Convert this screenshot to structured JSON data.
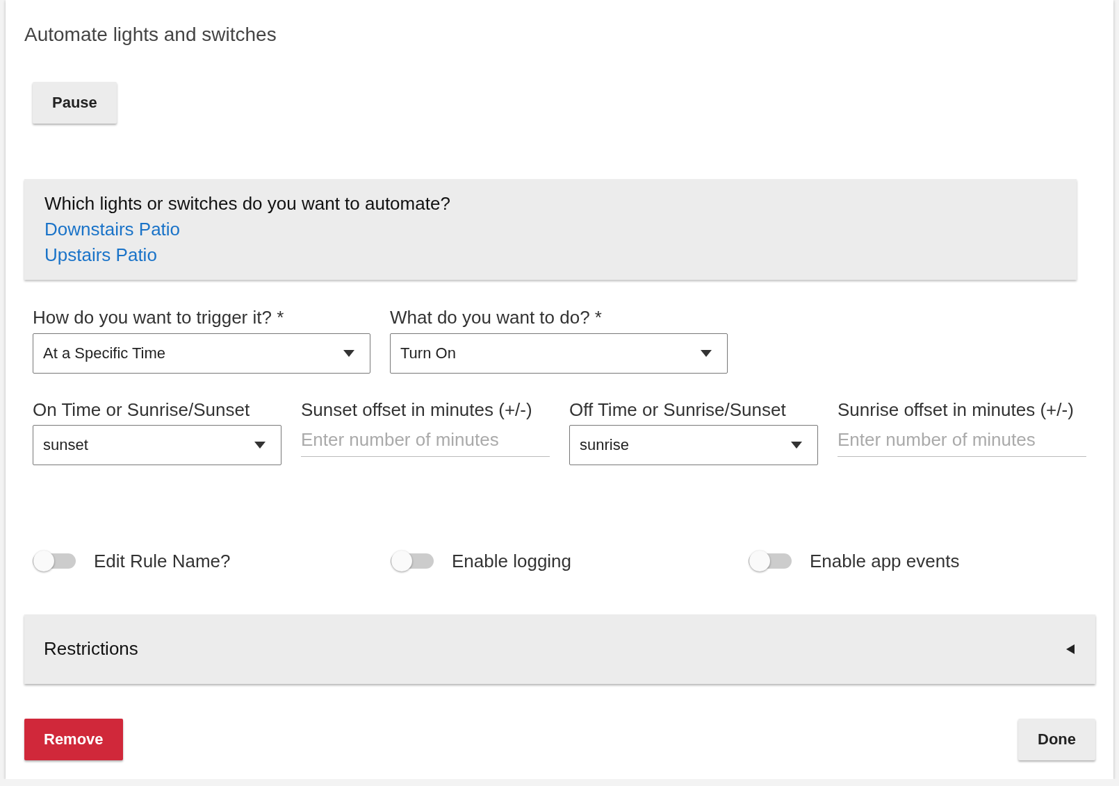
{
  "title": "Automate lights and switches",
  "pause_button": "Pause",
  "devices": {
    "question": "Which lights or switches do you want to automate?",
    "items": [
      "Downstairs Patio",
      "Upstairs Patio"
    ]
  },
  "trigger_row": [
    {
      "kind": "select",
      "label": "How do you want to trigger it? *",
      "value": "At a Specific Time"
    },
    {
      "kind": "select",
      "label": "What do you want to do? *",
      "value": "Turn On"
    }
  ],
  "schedule_row": [
    {
      "kind": "select",
      "label": "On Time or Sunrise/Sunset",
      "value": "sunset"
    },
    {
      "kind": "input",
      "label": "Sunset offset in minutes (+/-)",
      "placeholder": "Enter number of minutes"
    },
    {
      "kind": "select",
      "label": "Off Time or Sunrise/Sunset",
      "value": "sunrise"
    },
    {
      "kind": "input",
      "label": "Sunrise offset in minutes (+/-)",
      "placeholder": "Enter number of minutes"
    }
  ],
  "toggles": [
    {
      "label": "Edit Rule Name?",
      "on": false
    },
    {
      "label": "Enable logging",
      "on": false
    },
    {
      "label": "Enable app events",
      "on": false
    }
  ],
  "restrictions": {
    "title": "Restrictions",
    "expanded": false
  },
  "remove_button": "Remove",
  "done_button": "Done"
}
